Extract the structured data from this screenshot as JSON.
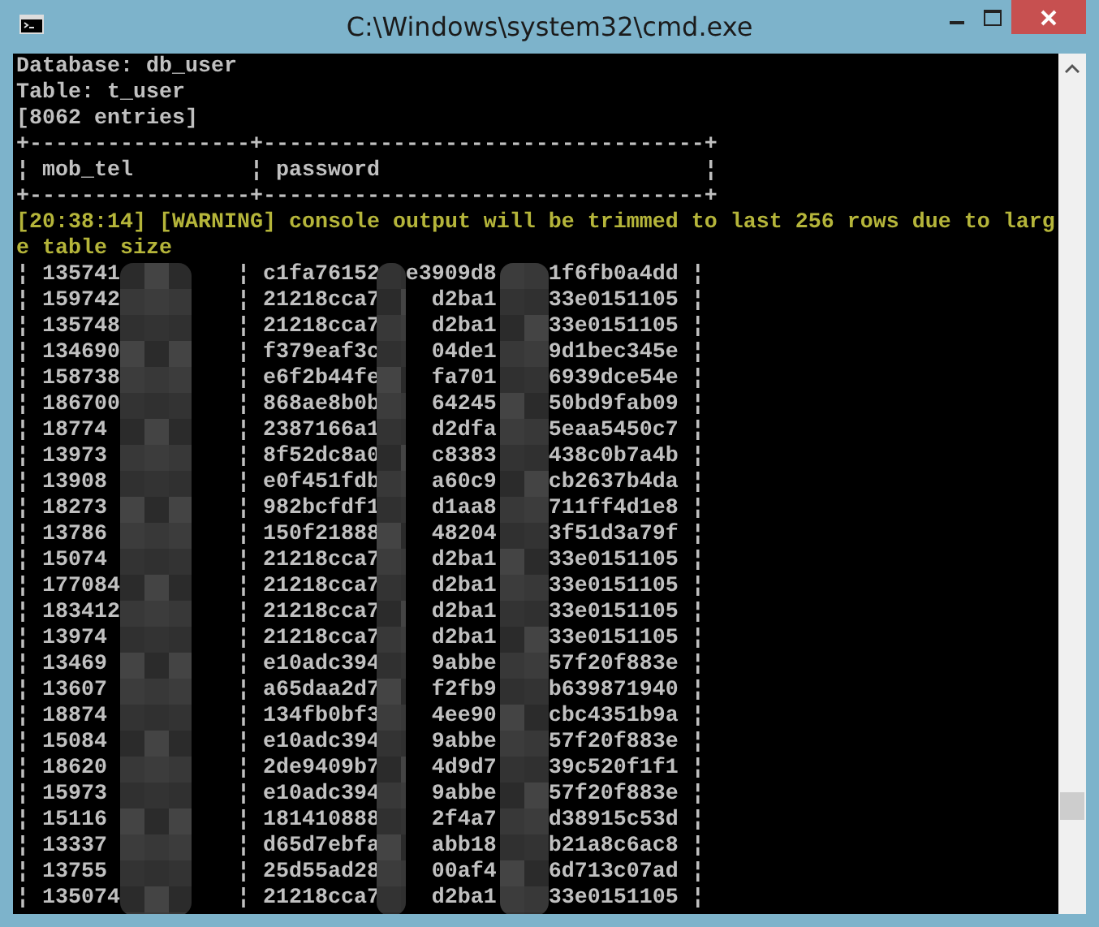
{
  "window": {
    "title": "C:\\Windows\\system32\\cmd.exe"
  },
  "console": {
    "lines": [
      {
        "kind": "info",
        "text": "Database: db_user"
      },
      {
        "kind": "info",
        "text": "Table: t_user"
      },
      {
        "kind": "info",
        "text": "[8062 entries]"
      },
      {
        "kind": "info",
        "text": "+-----------------+----------------------------------+"
      },
      {
        "kind": "info",
        "text": "¦ mob_tel         ¦ password                         ¦"
      },
      {
        "kind": "info",
        "text": "+-----------------+----------------------------------+"
      },
      {
        "kind": "warning",
        "text": "[20:38:14] [WARNING] console output will be trimmed to last 256 rows due to larg"
      },
      {
        "kind": "warning",
        "text": "e table size"
      }
    ],
    "rows": [
      {
        "mob_tel": "¦ 135741",
        "password": [
          "¦ c1fa76152",
          "e3909d8",
          "1f6fb0a4dd ¦"
        ]
      },
      {
        "mob_tel": "¦ 159742",
        "password": [
          "¦ 21218cca7",
          "d2ba1",
          "33e0151105 ¦"
        ]
      },
      {
        "mob_tel": "¦ 135748",
        "password": [
          "¦ 21218cca7",
          "d2ba1",
          "33e0151105 ¦"
        ]
      },
      {
        "mob_tel": "¦ 134690",
        "password": [
          "¦ f379eaf3c",
          "04de1",
          "9d1bec345e ¦"
        ]
      },
      {
        "mob_tel": "¦ 158738",
        "password": [
          "¦ e6f2b44fe",
          "fa701",
          "6939dce54e ¦"
        ]
      },
      {
        "mob_tel": "¦ 186700",
        "password": [
          "¦ 868ae8b0b",
          "64245",
          "50bd9fab09 ¦"
        ]
      },
      {
        "mob_tel": "¦ 18774",
        "password": [
          "¦ 2387166a1",
          "d2dfa",
          "5eaa5450c7 ¦"
        ]
      },
      {
        "mob_tel": "¦ 13973",
        "password": [
          "¦ 8f52dc8a0",
          "c8383",
          "438c0b7a4b ¦"
        ]
      },
      {
        "mob_tel": "¦ 13908",
        "password": [
          "¦ e0f451fdb",
          "a60c9",
          "cb2637b4da ¦"
        ]
      },
      {
        "mob_tel": "¦ 18273",
        "password": [
          "¦ 982bcfdf1",
          "d1aa8",
          "711ff4d1e8 ¦"
        ]
      },
      {
        "mob_tel": "¦ 13786",
        "password": [
          "¦ 150f21888",
          "48204",
          "3f51d3a79f ¦"
        ]
      },
      {
        "mob_tel": "¦ 15074",
        "password": [
          "¦ 21218cca7",
          "d2ba1",
          "33e0151105 ¦"
        ]
      },
      {
        "mob_tel": "¦ 177084",
        "password": [
          "¦ 21218cca7",
          "d2ba1",
          "33e0151105 ¦"
        ]
      },
      {
        "mob_tel": "¦ 183412",
        "password": [
          "¦ 21218cca7",
          "d2ba1",
          "33e0151105 ¦"
        ]
      },
      {
        "mob_tel": "¦ 13974",
        "password": [
          "¦ 21218cca7",
          "d2ba1",
          "33e0151105 ¦"
        ]
      },
      {
        "mob_tel": "¦ 13469",
        "password": [
          "¦ e10adc394",
          "9abbe",
          "57f20f883e ¦"
        ]
      },
      {
        "mob_tel": "¦ 13607",
        "password": [
          "¦ a65daa2d7",
          "f2fb9",
          "b639871940 ¦"
        ]
      },
      {
        "mob_tel": "¦ 18874",
        "password": [
          "¦ 134fb0bf3",
          "4ee90",
          "cbc4351b9a ¦"
        ]
      },
      {
        "mob_tel": "¦ 15084",
        "password": [
          "¦ e10adc394",
          "9abbe",
          "57f20f883e ¦"
        ]
      },
      {
        "mob_tel": "¦ 18620",
        "password": [
          "¦ 2de9409b7",
          "4d9d7",
          "39c520f1f1 ¦"
        ]
      },
      {
        "mob_tel": "¦ 15973",
        "password": [
          "¦ e10adc394",
          "9abbe",
          "57f20f883e ¦"
        ]
      },
      {
        "mob_tel": "¦ 15116",
        "password": [
          "¦ 181410888",
          "2f4a7",
          "d38915c53d ¦"
        ]
      },
      {
        "mob_tel": "¦ 13337",
        "password": [
          "¦ d65d7ebfa",
          "abb18",
          "b21a8c6ac8 ¦"
        ]
      },
      {
        "mob_tel": "¦ 13755",
        "password": [
          "¦ 25d55ad28",
          "00af4",
          "6d713c07ad ¦"
        ]
      },
      {
        "mob_tel": "¦ 135074",
        "password": [
          "¦ 21218cca7",
          "d2ba1",
          "33e0151105 ¦"
        ]
      }
    ]
  }
}
